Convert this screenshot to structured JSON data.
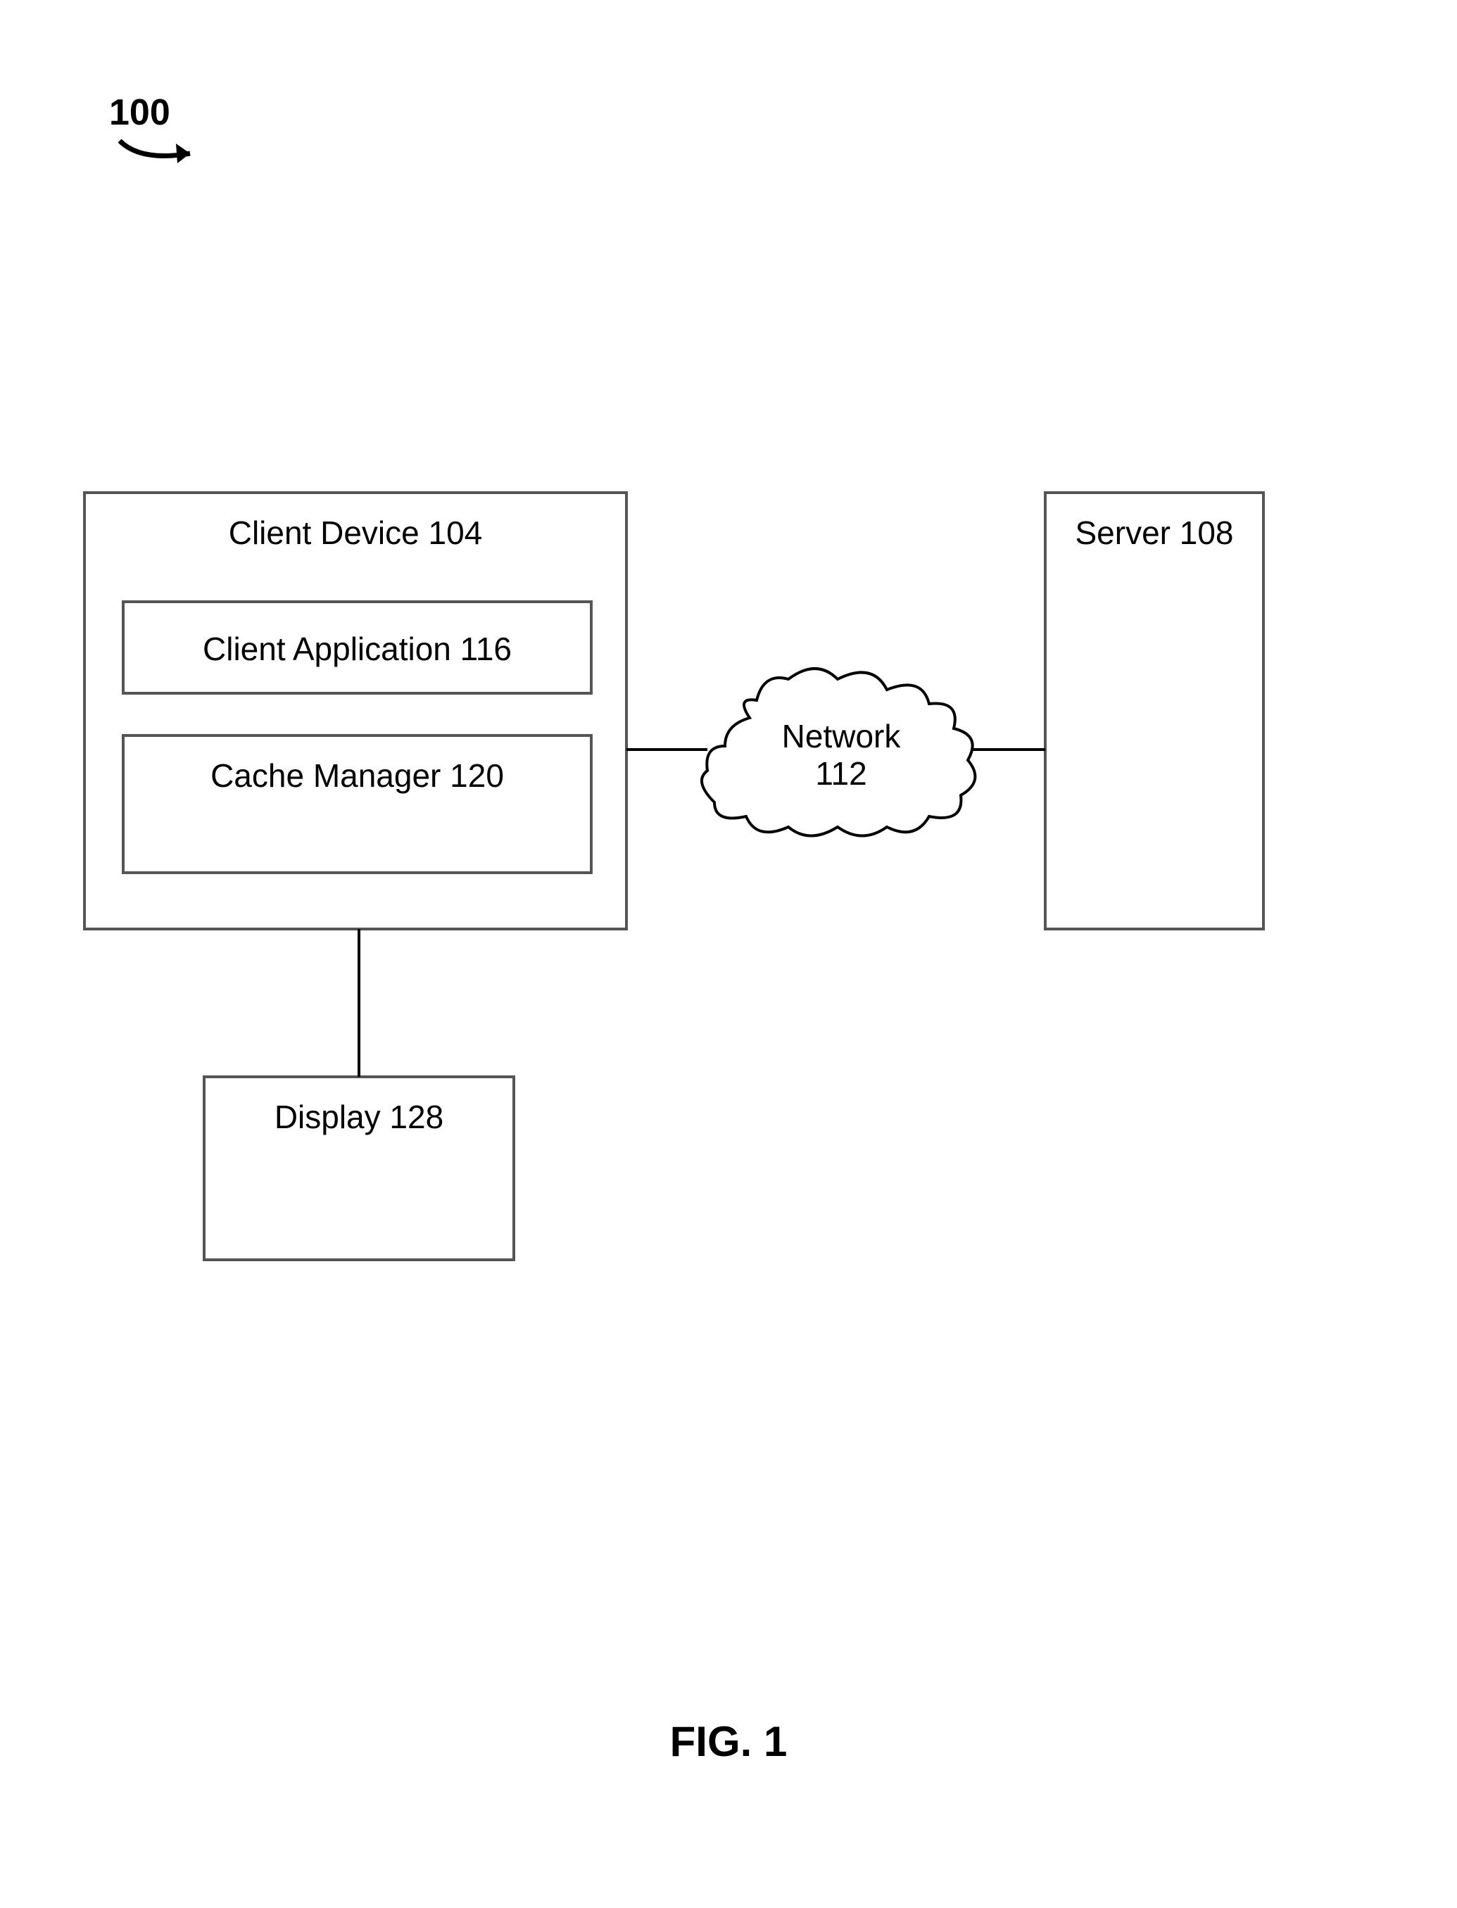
{
  "figure_ref": "100",
  "client_device": {
    "label": "Client Device 104"
  },
  "client_application": {
    "label": "Client Application 116"
  },
  "cache_manager": {
    "label": "Cache Manager 120"
  },
  "display": {
    "label": "Display 128"
  },
  "network": {
    "line1": "Network",
    "line2": "112"
  },
  "server": {
    "label": "Server 108"
  },
  "caption": "FIG. 1",
  "chart_data": {
    "type": "diagram",
    "title": "FIG. 1",
    "nodes": [
      {
        "id": "100",
        "label": "100",
        "kind": "reference"
      },
      {
        "id": "client_device_104",
        "label": "Client Device 104",
        "kind": "box",
        "children": [
          "client_application_116",
          "cache_manager_120"
        ]
      },
      {
        "id": "client_application_116",
        "label": "Client Application 116",
        "kind": "box"
      },
      {
        "id": "cache_manager_120",
        "label": "Cache Manager 120",
        "kind": "box"
      },
      {
        "id": "display_128",
        "label": "Display 128",
        "kind": "box"
      },
      {
        "id": "network_112",
        "label": "Network 112",
        "kind": "cloud"
      },
      {
        "id": "server_108",
        "label": "Server 108",
        "kind": "box"
      }
    ],
    "edges": [
      {
        "from": "client_device_104",
        "to": "network_112",
        "style": "line"
      },
      {
        "from": "network_112",
        "to": "server_108",
        "style": "line"
      },
      {
        "from": "client_device_104",
        "to": "display_128",
        "style": "line"
      }
    ]
  }
}
